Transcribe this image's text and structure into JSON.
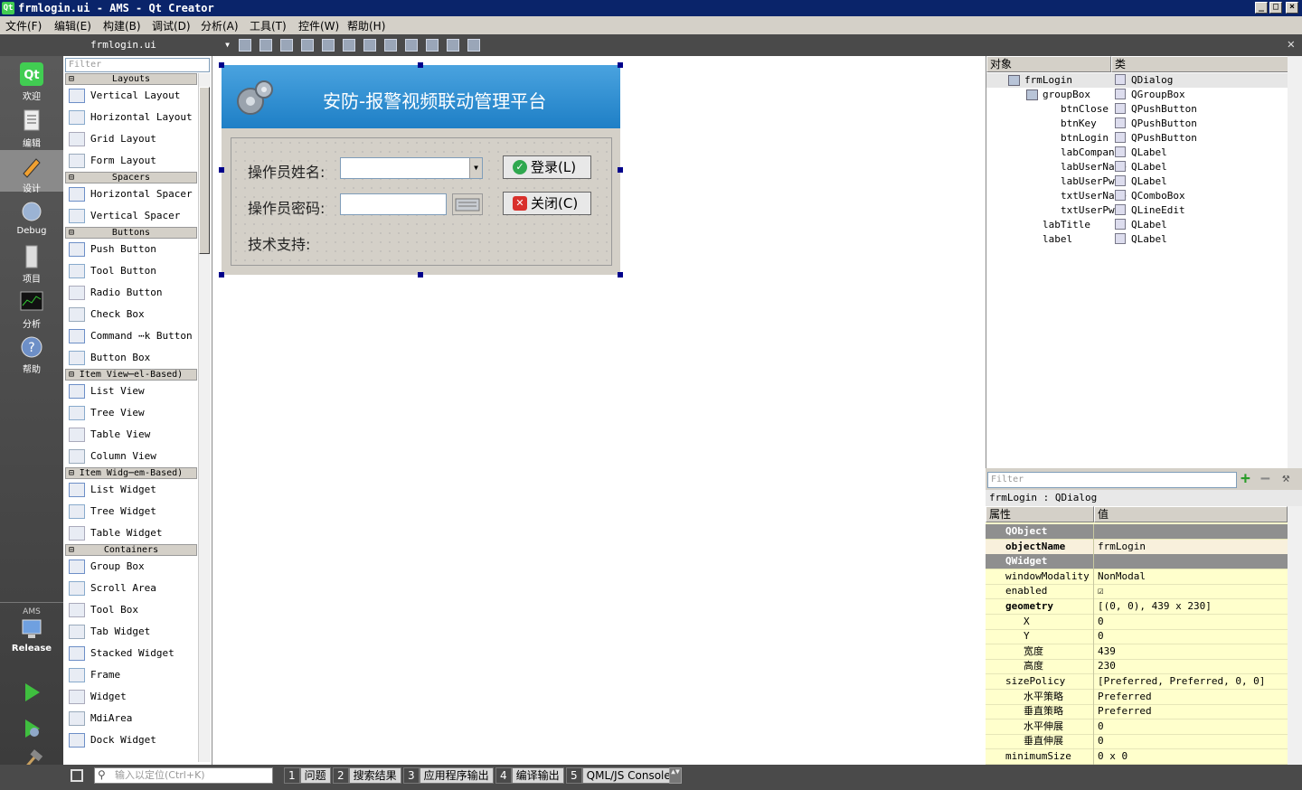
{
  "window": {
    "title": "frmlogin.ui - AMS - Qt Creator",
    "icon_name": "qt-icon"
  },
  "menu": [
    "文件(F)",
    "编辑(E)",
    "构建(B)",
    "调试(D)",
    "分析(A)",
    "工具(T)",
    "控件(W)",
    "帮助(H)"
  ],
  "editor": {
    "file_tab": "frmlogin.ui"
  },
  "modes": [
    {
      "label": "欢迎",
      "icon": "qt-logo-icon"
    },
    {
      "label": "编辑",
      "icon": "document-icon"
    },
    {
      "label": "设计",
      "icon": "pencil-icon"
    },
    {
      "label": "Debug",
      "icon": "debug-icon"
    },
    {
      "label": "项目",
      "icon": "project-icon"
    },
    {
      "label": "分析",
      "icon": "analyze-icon"
    },
    {
      "label": "帮助",
      "icon": "help-icon"
    }
  ],
  "kit": {
    "project": "AMS",
    "config": "Release"
  },
  "widget_box": {
    "filter_placeholder": "Filter",
    "categories": [
      {
        "name": "Layouts",
        "items": [
          "Vertical Layout",
          "Horizontal Layout",
          "Grid Layout",
          "Form Layout"
        ]
      },
      {
        "name": "Spacers",
        "items": [
          "Horizontal Spacer",
          "Vertical Spacer"
        ]
      },
      {
        "name": "Buttons",
        "items": [
          "Push Button",
          "Tool Button",
          "Radio Button",
          "Check Box",
          "Command ⋯k Button",
          "Button Box"
        ]
      },
      {
        "name": "Item View⋯el-Based)",
        "items": [
          "List View",
          "Tree View",
          "Table View",
          "Column View"
        ]
      },
      {
        "name": "Item Widg⋯em-Based)",
        "items": [
          "List Widget",
          "Tree Widget",
          "Table Widget"
        ]
      },
      {
        "name": "Containers",
        "items": [
          "Group Box",
          "Scroll Area",
          "Tool Box",
          "Tab Widget",
          "Stacked Widget",
          "Frame",
          "Widget",
          "MdiArea",
          "Dock Widget"
        ]
      }
    ]
  },
  "form": {
    "title": "安防-报警视频联动管理平台",
    "username_label": "操作员姓名:",
    "password_label": "操作员密码:",
    "support_label": "技术支持:",
    "login_button": "登录(L)",
    "close_button": "关闭(C)"
  },
  "object_inspector": {
    "col_object": "对象",
    "col_class": "类",
    "rows": [
      {
        "name": "frmLogin",
        "class": "QDialog"
      },
      {
        "name": "groupBox",
        "class": "QGroupBox"
      },
      {
        "name": "btnClose",
        "class": "QPushButton"
      },
      {
        "name": "btnKey",
        "class": "QPushButton"
      },
      {
        "name": "btnLogin",
        "class": "QPushButton"
      },
      {
        "name": "labCompany",
        "class": "QLabel"
      },
      {
        "name": "labUserName",
        "class": "QLabel"
      },
      {
        "name": "labUserPwd",
        "class": "QLabel"
      },
      {
        "name": "txtUserName",
        "class": "QComboBox"
      },
      {
        "name": "txtUserPwd",
        "class": "QLineEdit"
      },
      {
        "name": "labTitle",
        "class": "QLabel"
      },
      {
        "name": "label",
        "class": "QLabel"
      }
    ]
  },
  "property_editor": {
    "filter_placeholder": "Filter",
    "subtitle": "frmLogin : QDialog",
    "col_property": "属性",
    "col_value": "值",
    "rows": [
      {
        "name": "QObject",
        "value": "",
        "section": true
      },
      {
        "name": "objectName",
        "value": "frmLogin",
        "section": false
      },
      {
        "name": "QWidget",
        "value": "",
        "section": true
      },
      {
        "name": "windowModality",
        "value": "NonModal",
        "section": false
      },
      {
        "name": "enabled",
        "value": "☑",
        "section": false
      },
      {
        "name": "geometry",
        "value": "[(0, 0), 439 x 230]",
        "section": false
      },
      {
        "name": "X",
        "value": "0",
        "section": false
      },
      {
        "name": "Y",
        "value": "0",
        "section": false
      },
      {
        "name": "宽度",
        "value": "439",
        "section": false
      },
      {
        "name": "高度",
        "value": "230",
        "section": false
      },
      {
        "name": "sizePolicy",
        "value": "[Preferred, Preferred, 0, 0]",
        "section": false
      },
      {
        "name": "水平策略",
        "value": "Preferred",
        "section": false
      },
      {
        "name": "垂直策略",
        "value": "Preferred",
        "section": false
      },
      {
        "name": "水平伸展",
        "value": "0",
        "section": false
      },
      {
        "name": "垂直伸展",
        "value": "0",
        "section": false
      },
      {
        "name": "minimumSize",
        "value": "0 x 0",
        "section": false
      }
    ]
  },
  "statusbar": {
    "locate_placeholder": "输入以定位(Ctrl+K)",
    "panes": [
      {
        "num": "1",
        "label": "问题"
      },
      {
        "num": "2",
        "label": "搜索结果"
      },
      {
        "num": "3",
        "label": "应用程序输出"
      },
      {
        "num": "4",
        "label": "编译输出"
      },
      {
        "num": "5",
        "label": "QML/JS Console"
      }
    ]
  }
}
